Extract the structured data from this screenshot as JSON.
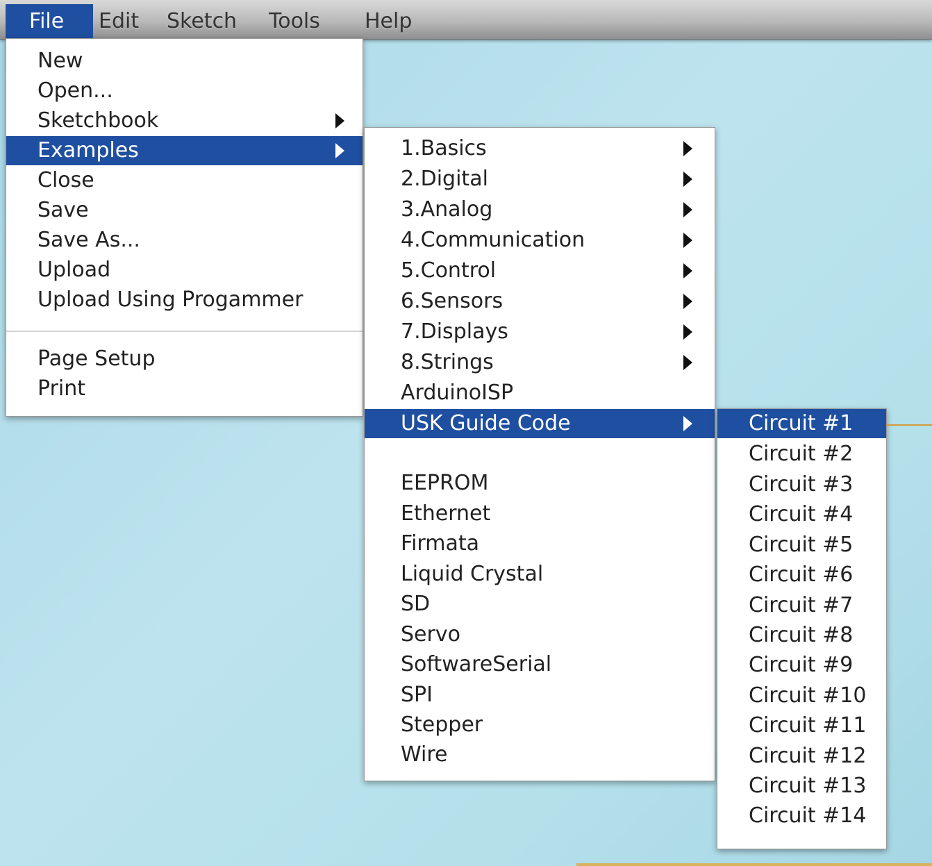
{
  "menubar": {
    "items": [
      "File",
      "Edit",
      "Sketch",
      "Tools",
      "Help"
    ]
  },
  "file_menu": {
    "items": [
      "New",
      "Open...",
      "Sketchbook",
      "Examples",
      "Close",
      "Save",
      "Save As...",
      "Upload",
      "Upload Using Progammer",
      "Page Setup",
      "Print"
    ]
  },
  "examples_menu": {
    "items": [
      "1.Basics",
      "2.Digital",
      "3.Analog",
      "4.Communication",
      "5.Control",
      "6.Sensors",
      "7.Displays",
      "8.Strings",
      "ArduinoISP",
      "USK Guide Code",
      "EEPROM",
      "Ethernet",
      "Firmata",
      "Liquid Crystal",
      "SD",
      "Servo",
      "SoftwareSerial",
      "SPI",
      "Stepper",
      "Wire"
    ]
  },
  "usk_menu": {
    "items": [
      "Circuit #1",
      "Circuit #2",
      "Circuit #3",
      "Circuit #4",
      "Circuit #5",
      "Circuit #6",
      "Circuit #7",
      "Circuit #8",
      "Circuit #9",
      "Circuit #10",
      "Circuit #11",
      "Circuit #12",
      "Circuit #13",
      "Circuit #14"
    ]
  },
  "colors": {
    "highlight": "#1f4fa0",
    "callout_line": "#d49a3c"
  },
  "icons": {
    "submenu_arrow": "triangle-right-icon"
  }
}
